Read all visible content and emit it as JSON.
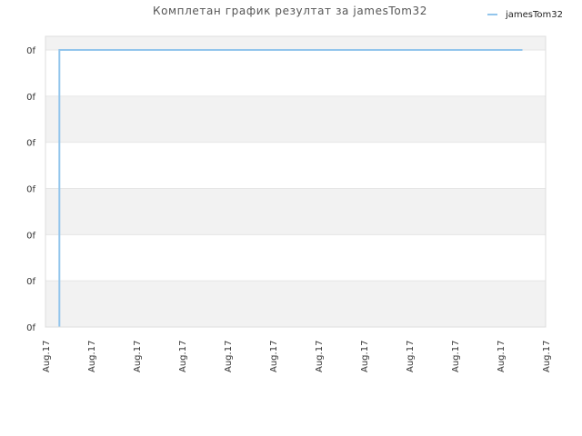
{
  "chart_data": {
    "type": "line",
    "title": "Комплетан график резултат за jamesTom32",
    "xlabel": "",
    "ylabel": "",
    "x_tick_labels": [
      "Aug.17",
      "Aug.17",
      "Aug.17",
      "Aug.17",
      "Aug.17",
      "Aug.17",
      "Aug.17",
      "Aug.17",
      "Aug.17",
      "Aug.17",
      "Aug.17",
      "Aug.17"
    ],
    "y_tick_labels": [
      "0f",
      "0f",
      "0f",
      "0f",
      "0f",
      "0f",
      "0f"
    ],
    "grid": true,
    "legend_position": "top-right",
    "series": [
      {
        "name": "jamesTom32",
        "color": "#92c5ec",
        "points": [
          {
            "x": 0.0,
            "y": 0
          },
          {
            "x": 0.0,
            "y": 1
          },
          {
            "x": 1.0,
            "y": 1
          }
        ]
      }
    ],
    "x_range": [
      -0.03,
      1.05
    ],
    "y_range": [
      0,
      1
    ]
  }
}
